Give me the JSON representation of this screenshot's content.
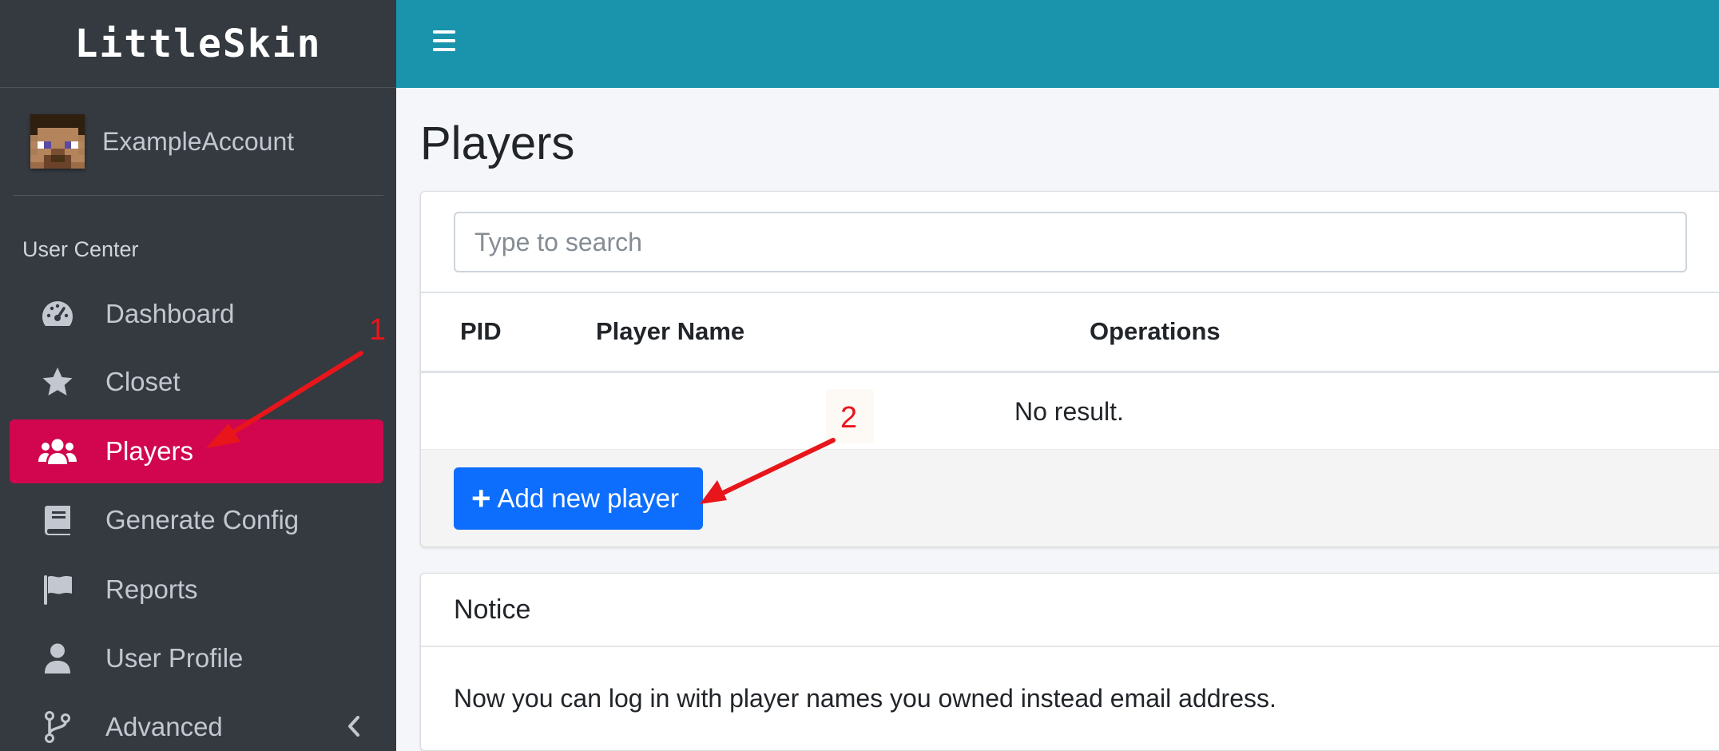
{
  "sidebar": {
    "brand": "LittleSkin",
    "user": {
      "name": "ExampleAccount"
    },
    "section_header": "User Center",
    "items": [
      {
        "label": "Dashboard",
        "icon": "dashboard-gauge-icon"
      },
      {
        "label": "Closet",
        "icon": "star-icon"
      },
      {
        "label": "Players",
        "icon": "users-icon",
        "active": true
      },
      {
        "label": "Generate Config",
        "icon": "book-icon"
      },
      {
        "label": "Reports",
        "icon": "flag-icon"
      },
      {
        "label": "User Profile",
        "icon": "user-icon"
      },
      {
        "label": "Advanced",
        "icon": "code-branch-icon",
        "expandable": true
      }
    ]
  },
  "header": {
    "menu_icon": "hamburger-icon"
  },
  "main": {
    "title": "Players",
    "search": {
      "placeholder": "Type to search",
      "value": ""
    },
    "table": {
      "columns": [
        "PID",
        "Player Name",
        "Operations"
      ],
      "empty_text": "No result."
    },
    "add_button_label": "Add new player",
    "notice": {
      "title": "Notice",
      "body": "Now you can log in with player names you owned instead email address."
    }
  },
  "annotations": [
    {
      "label": "1"
    },
    {
      "label": "2"
    }
  ],
  "colors": {
    "sidebar_bg": "#343a40",
    "topbar_bg": "#1a93ad",
    "active_item_bg": "#d1064f",
    "primary_button": "#0d6efd",
    "annotation_red": "#e8161b"
  }
}
